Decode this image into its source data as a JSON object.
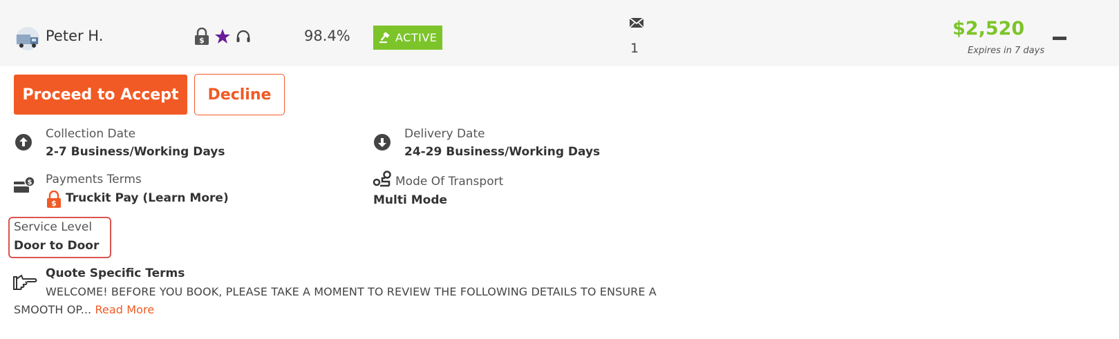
{
  "carrier": {
    "name": "Peter H.",
    "rating": "98.4%",
    "status": "ACTIVE",
    "badges": [
      "truckit-pay-lock-icon",
      "star-icon",
      "headset-icon"
    ]
  },
  "messages": {
    "count": "1",
    "icon": "envelope-icon"
  },
  "quote": {
    "price": "$2,520",
    "expires": "Expires in 7 days"
  },
  "actions": {
    "accept_label": "Proceed to Accept",
    "decline_label": "Decline"
  },
  "details": {
    "collection": {
      "label": "Collection Date",
      "value": "2-7 Business/Working Days"
    },
    "delivery": {
      "label": "Delivery Date",
      "value": "24-29 Business/Working Days"
    },
    "payment": {
      "label": "Payments Terms",
      "value": "Truckit Pay (Learn More)"
    },
    "transport": {
      "label": "Mode Of Transport",
      "value": "Multi Mode"
    },
    "service": {
      "label": "Service Level",
      "value": "Door to Door"
    }
  },
  "terms": {
    "title": "Quote Specific Terms",
    "line1": "WELCOME! BEFORE YOU BOOK, PLEASE TAKE A MOMENT TO REVIEW THE FOLLOWING DETAILS TO ENSURE A",
    "line2": "SMOOTH OP...",
    "read_more": "Read More"
  },
  "colors": {
    "accent_orange": "#f15a24",
    "price_green": "#7cc42a",
    "highlight_red": "#d9534f",
    "badge_purple": "#6a1b9a"
  }
}
